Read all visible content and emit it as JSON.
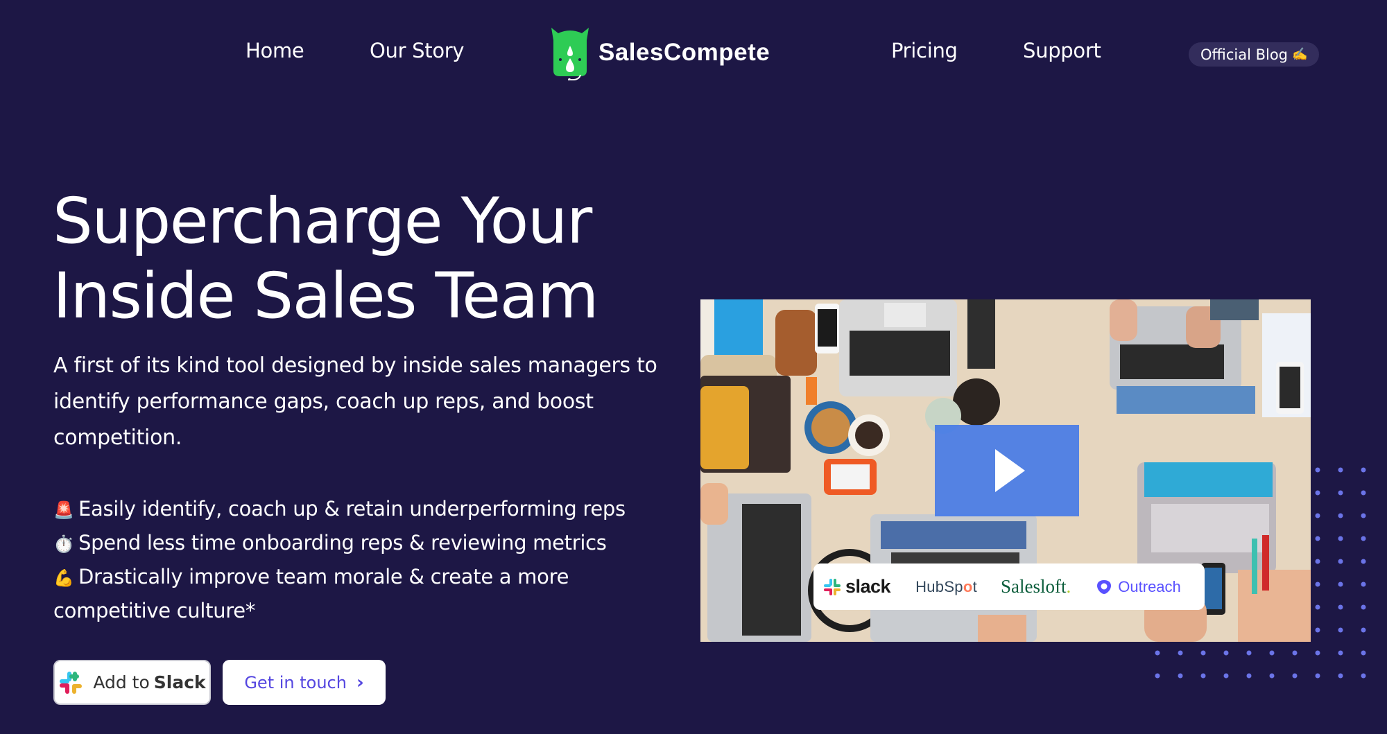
{
  "nav": {
    "left_links": [
      {
        "label": "Home"
      },
      {
        "label": "Our Story"
      }
    ],
    "brand": {
      "name": "SalesCompete",
      "icon": "rhino-logo-icon",
      "color": "#2ecc55"
    },
    "right_links": [
      {
        "label": "Pricing"
      },
      {
        "label": "Support"
      }
    ],
    "blog": {
      "label": "Official Blog",
      "emoji": "✍️"
    }
  },
  "hero": {
    "title_line1": "Supercharge Your",
    "title_line2": "Inside Sales Team",
    "subtitle": "A first of its kind tool designed by inside sales managers to identify performance gaps, coach up reps, and boost competition.",
    "benefits": [
      {
        "emoji": "🚨",
        "icon": "siren-icon",
        "text": "Easily identify, coach up & retain underperforming reps"
      },
      {
        "emoji": "⏱️",
        "icon": "stopwatch-icon",
        "text": "Spend less time onboarding reps & reviewing metrics"
      },
      {
        "emoji": "💪",
        "icon": "flexed-biceps-icon",
        "text": "Drastically improve team morale & create a more competitive culture*"
      }
    ],
    "buttons": {
      "slack_prefix": "Add to",
      "slack_brand": "Slack",
      "touch": "Get in touch",
      "touch_icon": "chevron-right-icon"
    }
  },
  "video": {
    "play_icon": "play-icon",
    "partners": [
      {
        "name": "slack",
        "icon": "slack-logo-icon"
      },
      {
        "name_prefix": "HubSp",
        "name_o": "o",
        "name_suffix": "t",
        "name": "HubSpot"
      },
      {
        "name": "Salesloft",
        "dot": "."
      },
      {
        "name": "Outreach",
        "icon": "outreach-logo-icon"
      }
    ]
  },
  "colors": {
    "background": "#1d1745",
    "accent": "#5547e0",
    "dots": "#6b74e8",
    "play_overlay": "#4076e8",
    "blog_pill": "#332d5c"
  }
}
